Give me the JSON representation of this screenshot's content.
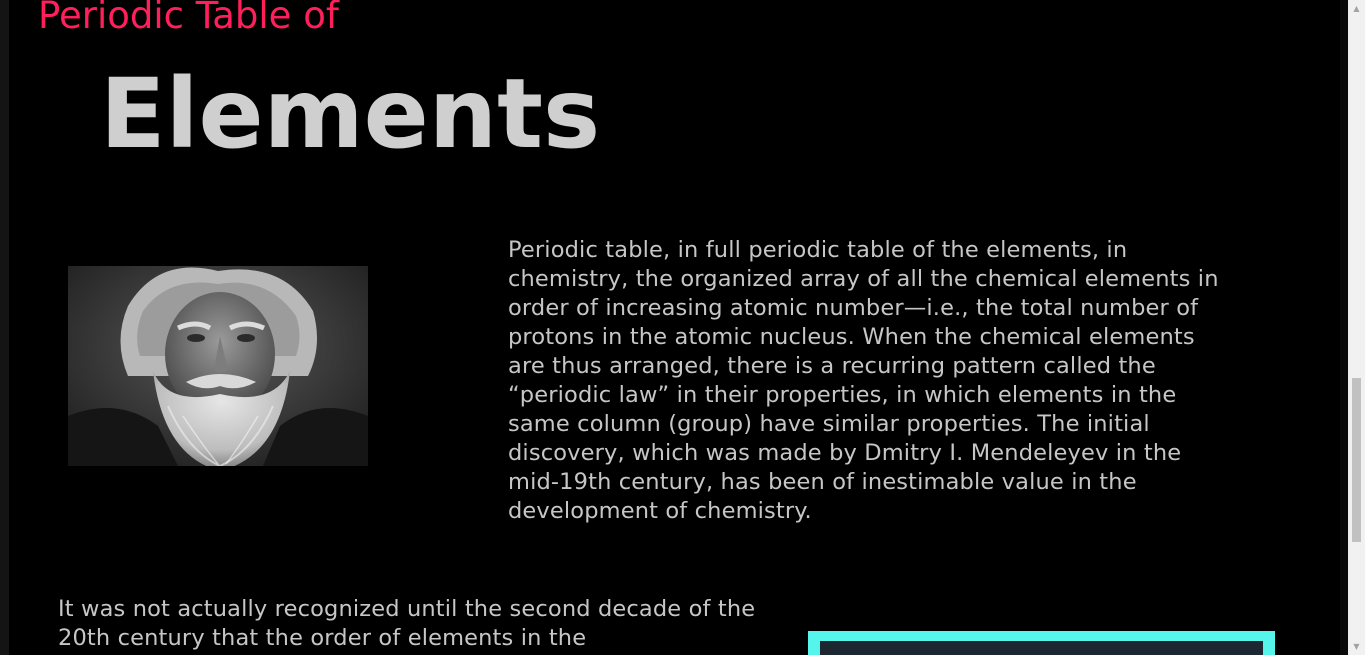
{
  "header": {
    "title_small": "Periodic Table of",
    "title_large": "Elements"
  },
  "portrait": {
    "alt": "Dmitry I. Mendeleyev portrait"
  },
  "content": {
    "intro_paragraph": "Periodic table, in full periodic table of the elements, in chemistry, the organized array of all the chemical elements in order of increasing atomic number—i.e., the total number of protons in the atomic nucleus. When the chemical elements are thus arranged, there is a recurring pattern called the “periodic law” in their properties, in which elements in the same column (group) have similar properties. The initial discovery, which was made by Dmitry I. Mendeleyev in the mid-19th century, has been of inestimable value in the development of chemistry.",
    "second_paragraph": "It was not actually recognized until the second decade of the 20th century that the order of elements in the"
  },
  "colors": {
    "background": "#000000",
    "title_small": "#ff1f5a",
    "title_large": "#cfcfcf",
    "body_text": "#c6c6c6",
    "box_border": "#55f5ec",
    "box_fill": "#1d2732"
  },
  "scrollbar": {
    "up_icon": "triangle-up",
    "down_icon": "triangle-down"
  }
}
